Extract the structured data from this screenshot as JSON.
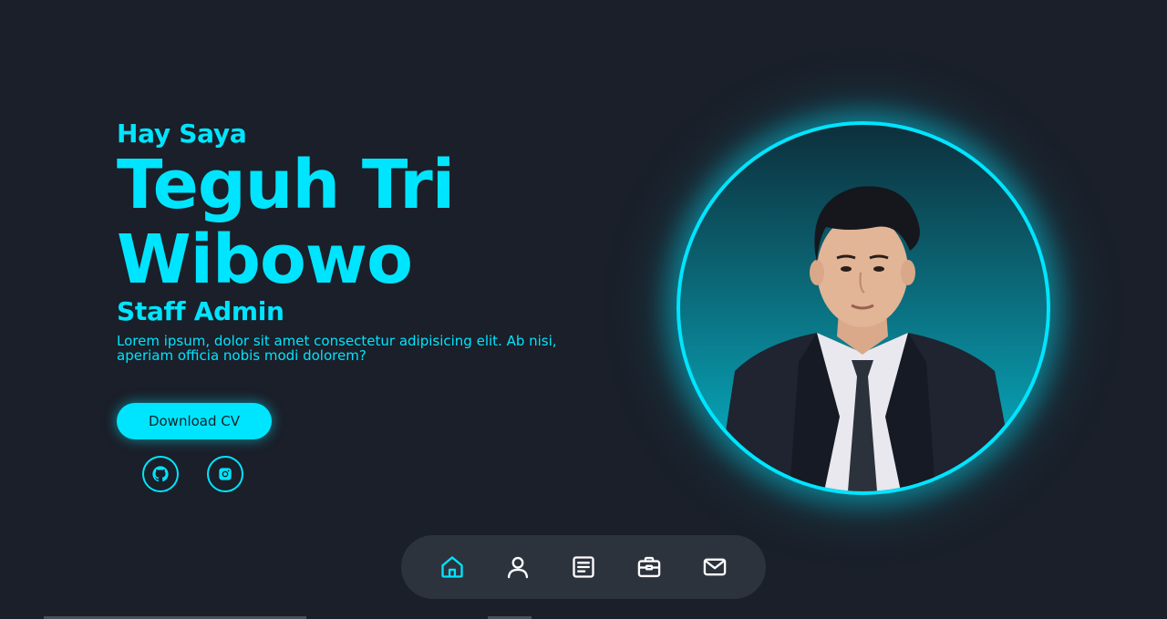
{
  "hero": {
    "greeting": "Hay Saya",
    "name_line1": "Teguh Tri",
    "name_line2": "Wibowo",
    "role": "Staff Admin",
    "description": "Lorem ipsum, dolor sit amet consectetur adipisicing elit. Ab nisi, aperiam officia nobis modi dolorem?",
    "download_label": "Download CV"
  },
  "social": [
    {
      "icon": "github-icon"
    },
    {
      "icon": "instagram-icon"
    }
  ],
  "nav": {
    "items": [
      {
        "icon": "home-icon",
        "active": true
      },
      {
        "icon": "user-icon",
        "active": false
      },
      {
        "icon": "document-icon",
        "active": false
      },
      {
        "icon": "briefcase-icon",
        "active": false
      },
      {
        "icon": "mail-icon",
        "active": false
      }
    ]
  },
  "colors": {
    "background": "#1a1f29",
    "accent": "#00e5ff",
    "nav_background": "#2d333d",
    "nav_icon": "#ffffff"
  }
}
